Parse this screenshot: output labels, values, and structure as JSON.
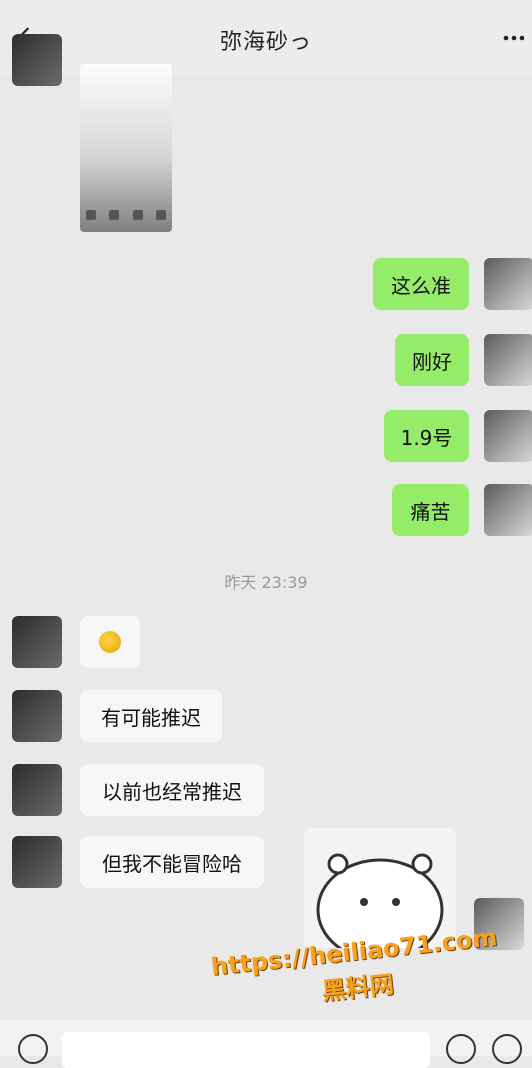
{
  "header": {
    "title": "弥海砂っ"
  },
  "chat": {
    "messages_mine": [
      {
        "text": "这么准"
      },
      {
        "text": "刚好"
      },
      {
        "text": "1.9号"
      },
      {
        "text": "痛苦"
      }
    ],
    "timestamp": "昨天 23:39",
    "messages_theirs": [
      {
        "text": "有可能推迟"
      },
      {
        "text": "以前也经常推迟"
      },
      {
        "text": "但我不能冒险哈"
      }
    ]
  },
  "watermark": {
    "url": "https://heiliao71.com",
    "brand": "黑料网"
  },
  "colors": {
    "my_bubble": "#95ec69",
    "their_bubble": "#f7f7f7",
    "background": "#e9e9e9"
  }
}
